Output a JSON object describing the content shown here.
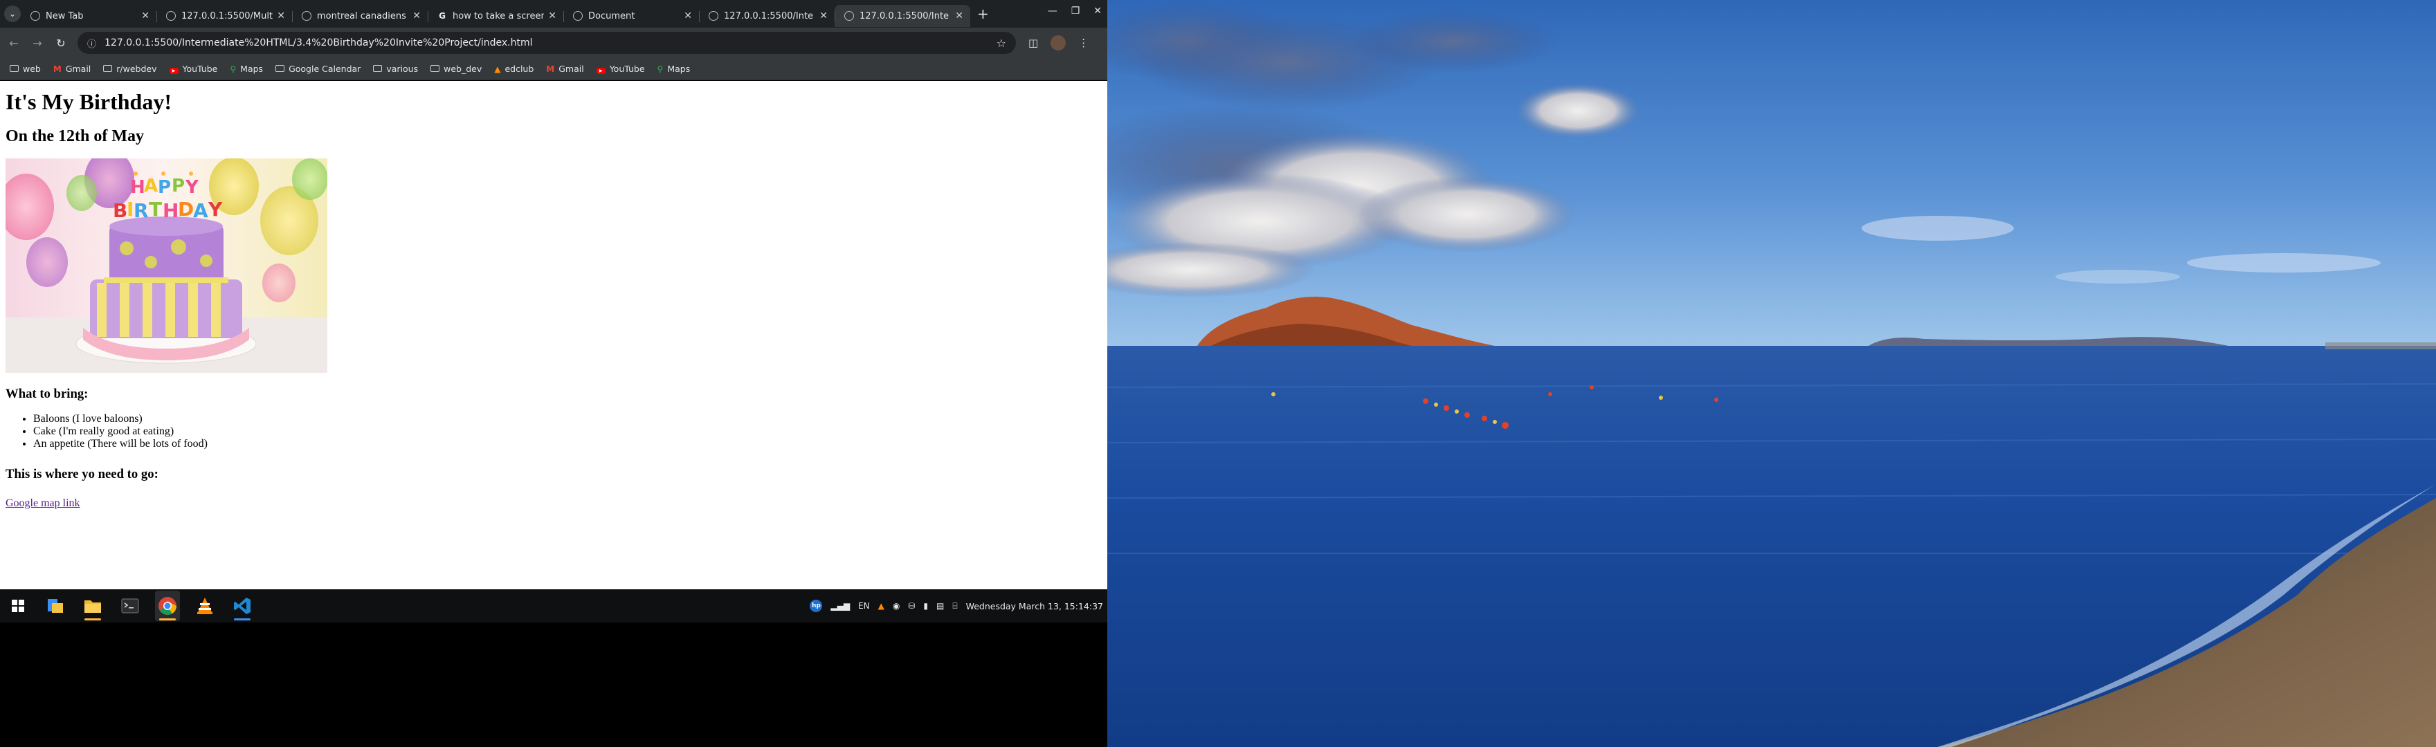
{
  "browser": {
    "tabs": [
      {
        "title": "New Tab",
        "icon": "chrome-icon",
        "active": false
      },
      {
        "title": "127.0.0.1:5500/Mult",
        "icon": "globe-icon",
        "active": false
      },
      {
        "title": "montreal canadiens",
        "icon": "globe-icon",
        "active": false
      },
      {
        "title": "how to take a screen",
        "icon": "google-icon",
        "active": false
      },
      {
        "title": "Document",
        "icon": "globe-icon",
        "active": false
      },
      {
        "title": "127.0.0.1:5500/Inte",
        "icon": "globe-icon",
        "active": false
      },
      {
        "title": "127.0.0.1:5500/Inte",
        "icon": "globe-icon",
        "active": true
      }
    ],
    "new_tab_symbol": "+",
    "url": "127.0.0.1:5500/Intermediate%20HTML/3.4%20Birthday%20Invite%20Project/index.html",
    "bookmarks": [
      {
        "label": "web",
        "icon": "folder-icon"
      },
      {
        "label": "Gmail",
        "icon": "gmail-icon"
      },
      {
        "label": "r/webdev",
        "icon": "folder-icon"
      },
      {
        "label": "YouTube",
        "icon": "youtube-icon"
      },
      {
        "label": "Maps",
        "icon": "maps-icon"
      },
      {
        "label": "Google Calendar",
        "icon": "folder-icon"
      },
      {
        "label": "various",
        "icon": "folder-icon"
      },
      {
        "label": "web_dev",
        "icon": "folder-icon"
      },
      {
        "label": "edclub",
        "icon": "edclub-icon"
      },
      {
        "label": "Gmail",
        "icon": "gmail-icon"
      },
      {
        "label": "YouTube",
        "icon": "youtube-icon"
      },
      {
        "label": "Maps",
        "icon": "maps-icon"
      }
    ]
  },
  "page": {
    "heading": "It's My Birthday!",
    "subheading": "On the 12th of May",
    "image_text": "HAPPY BIRTHDAY",
    "bring_heading": "What to bring:",
    "bring_items": [
      "Baloons (I love baloons)",
      "Cake (I'm really good at eating)",
      "An appetite (There will be lots of food)"
    ],
    "where_heading": "This is where yo need to go:",
    "map_link": "Google map link"
  },
  "taskbar": {
    "apps": [
      "windows-start-icon",
      "file-explorer-icon",
      "folder-icon",
      "terminal-icon",
      "chrome-icon",
      "vlc-icon",
      "vscode-icon"
    ],
    "language": "EN",
    "datetime": "Wednesday March 13, 15:14:37"
  },
  "colors": {
    "accent_running": "#ffb43a",
    "link_visited": "#551a8b"
  }
}
